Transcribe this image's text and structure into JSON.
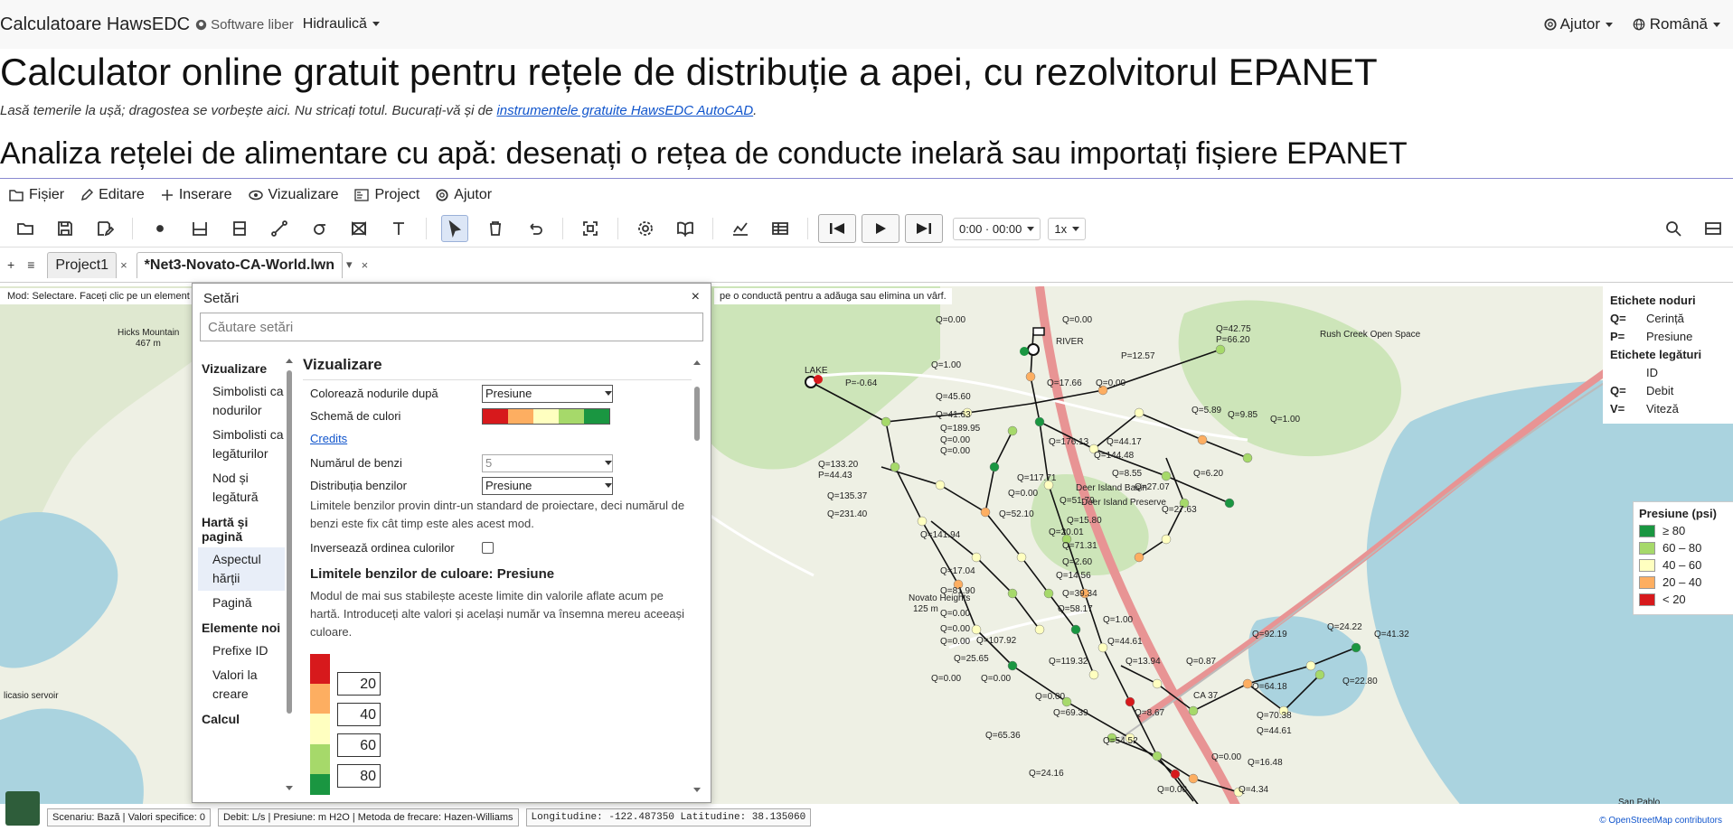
{
  "nav": {
    "brand": "Calculatoare HawsEDC",
    "software": "Software liber",
    "dropdown": "Hidraulică",
    "help": "Ajutor",
    "language": "Română"
  },
  "page": {
    "title": "Calculator online gratuit pentru rețele de distribuție a apei, cu rezolvitorul EPANET",
    "tagline_prefix": "Lasă temerile la ușă; dragostea se vorbește aici. Nu stricați totul. Bucurați-vă și de ",
    "tagline_link": "instrumentele gratuite HawsEDC AutoCAD",
    "tagline_suffix": ".",
    "subtitle": "Analiza rețelei de alimentare cu apă: desenați o rețea de conducte inelară sau importați fișiere EPANET"
  },
  "menu": {
    "file": "Fișier",
    "edit": "Editare",
    "insert": "Inserare",
    "view": "Vizualizare",
    "project": "Project",
    "help": "Ajutor"
  },
  "toolbar": {
    "time": "0:00 · 00:00",
    "speed": "1x"
  },
  "tabs": {
    "new": "+",
    "list": "≡",
    "tab1": "Project1",
    "tab2": "*Net3-Novato-CA-World.lwn",
    "close": "×",
    "more": "▾"
  },
  "map": {
    "mode_text": "Mod: Selectare. Faceți clic pe un element",
    "mode_text_right": "pe o conductă pentru a adăuga sau elimina un vârf.",
    "node_labels_title": "Etichete noduri",
    "node_labels": [
      {
        "k": "Q=",
        "v": "Cerință"
      },
      {
        "k": "P=",
        "v": "Presiune"
      }
    ],
    "link_labels_title": "Etichete legături",
    "link_labels": [
      {
        "k": "",
        "v": "ID"
      },
      {
        "k": "Q=",
        "v": "Debit"
      },
      {
        "k": "V=",
        "v": "Viteză"
      }
    ],
    "pressure_legend_title": "Presiune (psi)",
    "pressure_legend": [
      {
        "label": "≥ 80",
        "color": "#1a9641"
      },
      {
        "label": "60 – 80",
        "color": "#a6d96a"
      },
      {
        "label": "40 – 60",
        "color": "#ffffc0"
      },
      {
        "label": "20 – 40",
        "color": "#fdae61"
      },
      {
        "label": "< 20",
        "color": "#d7191c"
      }
    ],
    "place_labels": [
      "Hicks Mountain",
      "467 m",
      "Novato Heights",
      "125 m",
      "Deer Island Basin",
      "Deer Island Preserve",
      "Rush Creek Open Space",
      "San Pablo",
      "LAKE",
      "RIVER",
      "CA 37",
      "licasio servoir"
    ],
    "flow_labels": [
      "Q=0.00",
      "Q=0.00",
      "P=12.57",
      "Q=42.75",
      "P=66.20",
      "Q=1.00",
      "Q=17.66",
      "Q=0.00",
      "Q=45.60",
      "Q=5.89",
      "Q=9.85",
      "Q=1.00",
      "Q=41.63",
      "Q=189.95",
      "Q=0.00",
      "Q=0.00",
      "Q=176.13",
      "Q=44.17",
      "Q=144.48",
      "Q=133.20",
      "P=44.43",
      "Q=8.55",
      "Q=6.20",
      "Q=117.71",
      "Q=27.07",
      "Q=135.37",
      "Q=0.00",
      "Q=51.79",
      "Q=27.63",
      "Q=231.40",
      "Q=52.10",
      "Q=15.80",
      "Q=20.01",
      "Q=141.94",
      "Q=71.31",
      "Q=2.60",
      "Q=17.04",
      "Q=14.56",
      "Q=81.90",
      "Q=39.34",
      "Q=58.17",
      "Q=0.00",
      "Q=1.00",
      "Q=0.00",
      "Q=107.92",
      "Q=0.00",
      "Q=44.61",
      "Q=92.19",
      "Q=24.22",
      "Q=41.32",
      "Q=25.65",
      "Q=119.32",
      "Q=13.94",
      "Q=0.87",
      "Q=0.00",
      "Q=0.00",
      "Q=0.00",
      "Q=22.80",
      "Q=64.18",
      "Q=69.39",
      "Q=8.67",
      "Q=70.38",
      "Q=65.36",
      "Q=54.52",
      "Q=44.61",
      "Q=0.00",
      "Q=16.48",
      "Q=24.16",
      "Q=4.34",
      "Q=0.00",
      "P=-0.64"
    ]
  },
  "settings": {
    "title": "Setări",
    "close": "×",
    "search_placeholder": "Căutare setări",
    "nav": [
      {
        "type": "grp",
        "label": "Vizualizare"
      },
      {
        "type": "it",
        "label": "Simbolisti ca nodurilor"
      },
      {
        "type": "it",
        "label": "Simbolisti ca legăturilor"
      },
      {
        "type": "it",
        "label": "Nod și legătură"
      },
      {
        "type": "grp",
        "label": "Hartă și pagină"
      },
      {
        "type": "it",
        "label": "Aspectul hărții",
        "active": true
      },
      {
        "type": "it",
        "label": "Pagină"
      },
      {
        "type": "grp",
        "label": "Elemente noi"
      },
      {
        "type": "it",
        "label": "Prefixe ID"
      },
      {
        "type": "it",
        "label": "Valori la creare"
      },
      {
        "type": "grp",
        "label": "Calcul"
      }
    ],
    "section_title": "Vizualizare",
    "color_nodes_label": "Colorează nodurile după",
    "color_nodes_value": "Presiune",
    "color_scheme_label": "Schemă de culori",
    "color_scheme": [
      "#d7191c",
      "#fdae61",
      "#ffffc0",
      "#a6d96a",
      "#1a9641"
    ],
    "credits": "Credits",
    "bands_label": "Numărul de benzi",
    "bands_value": "5",
    "band_dist_label": "Distribuția benzilor",
    "band_dist_value": "Presiune",
    "band_note": "Limitele benzilor provin dintr-un standard de proiectare, deci numărul de benzi este fix cât timp este ales acest mod.",
    "reverse_label": "Inversează ordinea culorilor",
    "limits_title": "Limitele benzilor de culoare: Presiune",
    "limits_note": "Modul de mai sus stabilește aceste limite din valorile aflate acum pe hartă. Introduceți alte valori și același număr va însemna mereu aceeași culoare.",
    "limits": [
      "20",
      "40",
      "60",
      "80"
    ]
  },
  "status": {
    "scenario": "Scenariu: Bază | Valori specifice: 0",
    "units": "Debit: L/s | Presiune: m H2O | Metoda de frecare: Hazen-Williams",
    "coords": "Longitudine: -122.487350  Latitudine: 38.135060",
    "osm": "© OpenStreetMap contributors"
  }
}
